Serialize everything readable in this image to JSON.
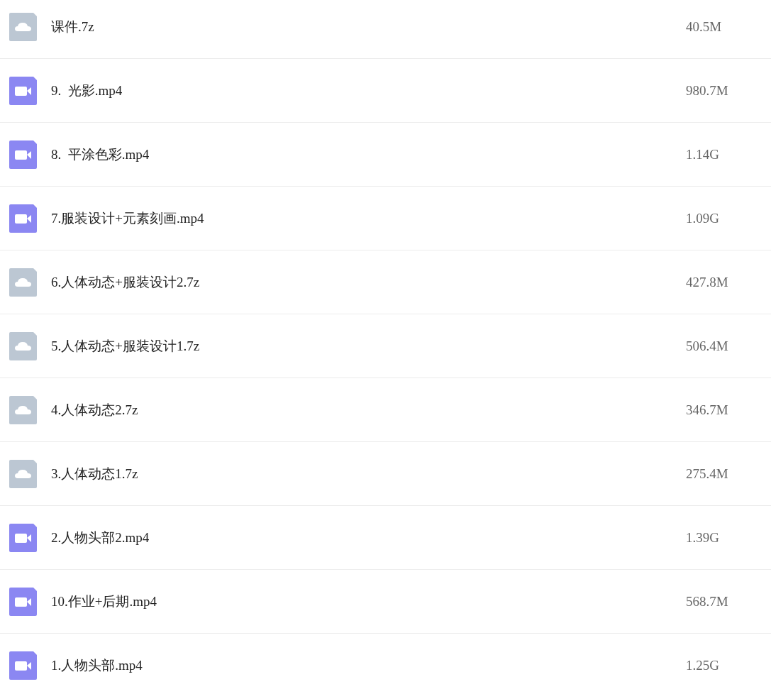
{
  "files": [
    {
      "kind": "archive",
      "name": "课件.7z",
      "size": "40.5M"
    },
    {
      "kind": "video",
      "name": "9.  光影.mp4",
      "size": "980.7M"
    },
    {
      "kind": "video",
      "name": "8.  平涂色彩.mp4",
      "size": "1.14G"
    },
    {
      "kind": "video",
      "name": "7.服装设计+元素刻画.mp4",
      "size": "1.09G"
    },
    {
      "kind": "archive",
      "name": "6.人体动态+服装设计2.7z",
      "size": "427.8M"
    },
    {
      "kind": "archive",
      "name": "5.人体动态+服装设计1.7z",
      "size": "506.4M"
    },
    {
      "kind": "archive",
      "name": "4.人体动态2.7z",
      "size": "346.7M"
    },
    {
      "kind": "archive",
      "name": "3.人体动态1.7z",
      "size": "275.4M"
    },
    {
      "kind": "video",
      "name": "2.人物头部2.mp4",
      "size": "1.39G"
    },
    {
      "kind": "video",
      "name": "10.作业+后期.mp4",
      "size": "568.7M"
    },
    {
      "kind": "video",
      "name": "1.人物头部.mp4",
      "size": "1.25G"
    }
  ]
}
